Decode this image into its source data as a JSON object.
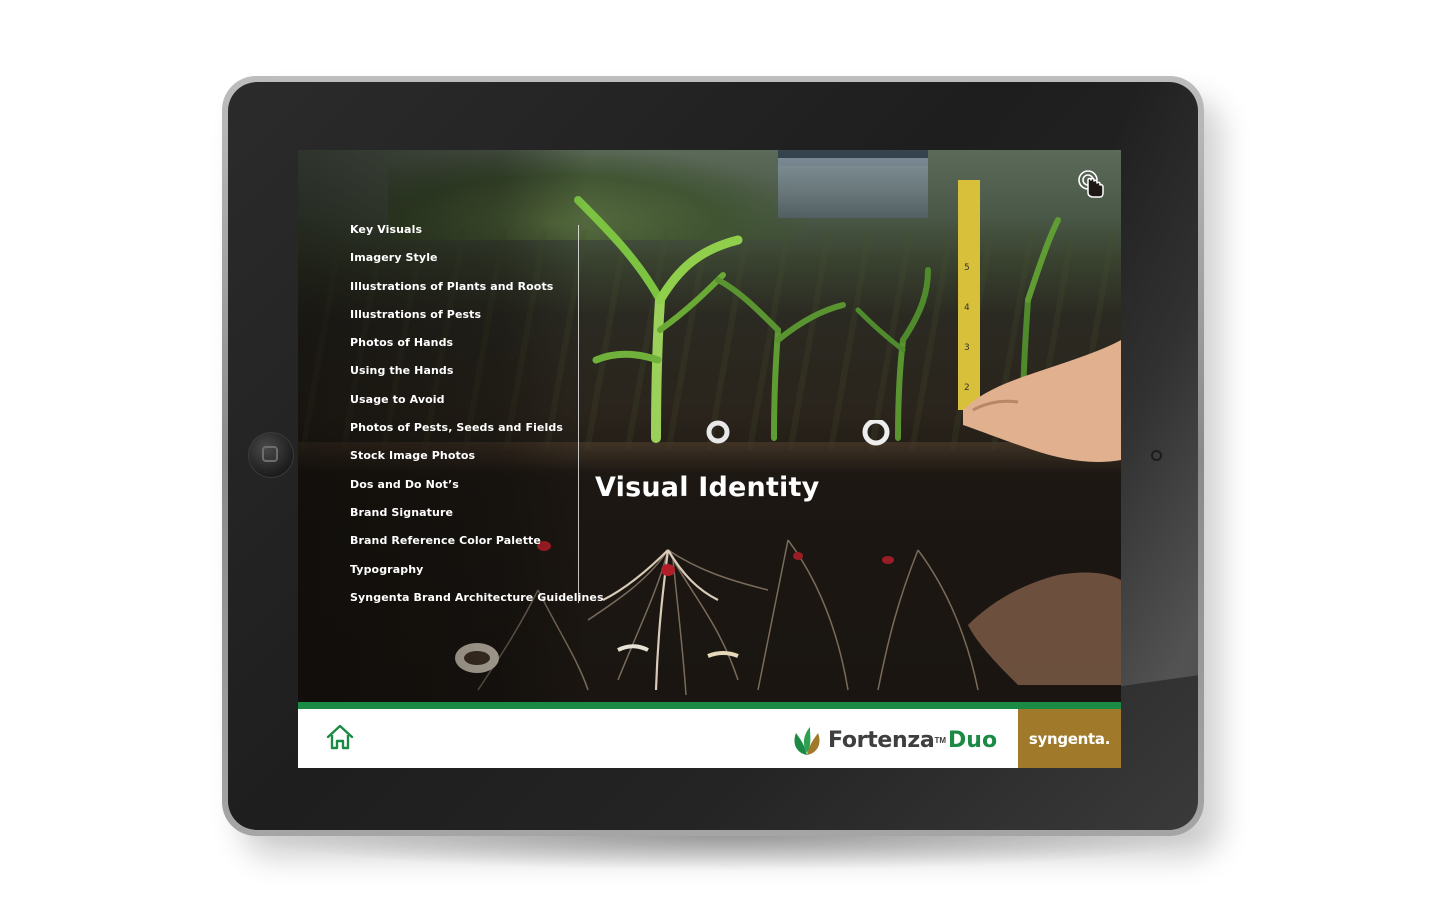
{
  "menu": {
    "items": [
      {
        "label": "Key Visuals"
      },
      {
        "label": "Imagery Style"
      },
      {
        "label": "Illustrations of Plants and Roots"
      },
      {
        "label": "Illustrations of Pests"
      },
      {
        "label": "Photos of Hands"
      },
      {
        "label": "Using the Hands"
      },
      {
        "label": "Usage to Avoid"
      },
      {
        "label": "Photos of Pests, Seeds and Fields"
      },
      {
        "label": "Stock Image Photos"
      },
      {
        "label": "Dos and Do Not’s"
      },
      {
        "label": "Brand Signature"
      },
      {
        "label": "Brand Reference Color Palette"
      },
      {
        "label": "Typography"
      },
      {
        "label": "Syngenta Brand Architecture Guidelines"
      }
    ]
  },
  "page": {
    "title": "Visual Identity"
  },
  "footer": {
    "brand_name": "Fortenza",
    "brand_tm": "TM",
    "brand_suffix": "Duo",
    "company": "syngenta."
  },
  "icons": {
    "touch": "touch-gesture-icon",
    "home": "home-icon"
  },
  "colors": {
    "accent_green": "#1a8a45",
    "syngenta_gold": "#a07a2a"
  }
}
